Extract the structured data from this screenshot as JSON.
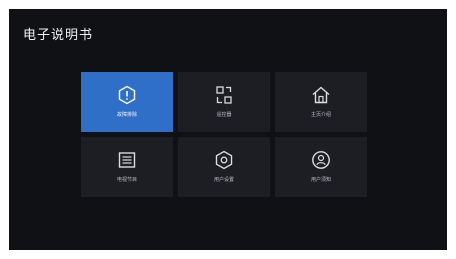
{
  "app": {
    "title": "电子说明书"
  },
  "tiles": [
    {
      "label": "故障排除",
      "icon": "info-hexagon-icon",
      "selected": true
    },
    {
      "label": "遥控器",
      "icon": "remote-icon",
      "selected": false
    },
    {
      "label": "主页介绍",
      "icon": "home-icon",
      "selected": false
    },
    {
      "label": "电视节目",
      "icon": "tv-program-icon",
      "selected": false
    },
    {
      "label": "用户设置",
      "icon": "settings-hexagon-icon",
      "selected": false
    },
    {
      "label": "用户须知",
      "icon": "user-notice-icon",
      "selected": false
    }
  ],
  "colors": {
    "background": "#101114",
    "tile": "#1c1e23",
    "selected": "#2f6fc7"
  }
}
